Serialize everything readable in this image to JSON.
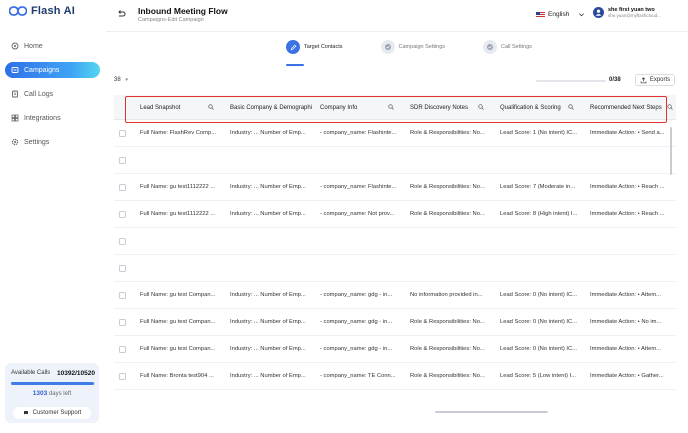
{
  "app": {
    "logo_text": "Flash AI",
    "nav": [
      {
        "label": "Home",
        "icon": "home-icon",
        "active": false
      },
      {
        "label": "Campaigns",
        "icon": "campaign-icon",
        "active": true
      },
      {
        "label": "Call Logs",
        "icon": "call-logs-icon",
        "active": false
      },
      {
        "label": "Integrations",
        "icon": "integrations-icon",
        "active": false
      },
      {
        "label": "Settings",
        "icon": "settings-icon",
        "active": false
      }
    ],
    "calls": {
      "label": "Available Calls",
      "value": "10392/10520",
      "fraction": 0.988,
      "days_number": "1303",
      "days_label": "days left",
      "support_label": "Customer Support"
    }
  },
  "header": {
    "title": "Inbound Meeting Flow",
    "subtitle": "Campaigns-Edit Campaign",
    "language": "English",
    "user_name": "she first yuan two",
    "user_email": "she.yuan@myflashcloud..."
  },
  "steps": [
    {
      "label": "Target Contacts",
      "icon": "edit-icon",
      "active": true
    },
    {
      "label": "Campaign Settings",
      "icon": "check-icon",
      "active": false
    },
    {
      "label": "Call Settings",
      "icon": "check-icon",
      "active": false
    }
  ],
  "toolbar": {
    "page_size": "38",
    "selected_count": "0/38",
    "export_label": "Exports"
  },
  "table": {
    "columns": [
      "Lead Snapshot",
      "Basic Company & Demographi",
      "Company Info",
      "SDR Discovery Notes",
      "Qualification & Scoring",
      "Recommended Next Steps"
    ],
    "rows": [
      [
        "Full Name: FlashRev Comp...",
        "Industry: ... Number of Emp...",
        "- company_name: Flashinte...",
        "Role & Responsibilities: No...",
        "Lead Score: 1 (No intent) IC...",
        "Immediate Action: • Send a..."
      ],
      [
        "",
        "",
        "",
        "",
        "",
        ""
      ],
      [
        "Full Name: gu test1112222 ...",
        "Industry: ... Number of Emp...",
        "- company_name: Flashinte...",
        "Role & Responsibilities: No...",
        "Lead Score: 7 (Moderate in...",
        "Immediate Action: • Reach ..."
      ],
      [
        "Full Name: gu test1112222 ...",
        "Industry: ... Number of Emp...",
        "- company_name: Not prov...",
        "Role & Responsibilities: No...",
        "Lead Score: 8 (High intent) I...",
        "Immediate Action: • Reach ..."
      ],
      [
        "",
        "",
        "",
        "",
        "",
        ""
      ],
      [
        "",
        "",
        "",
        "",
        "",
        ""
      ],
      [
        "Full Name: gu test Compan...",
        "Industry: ... Number of Emp...",
        "- company_name: gdg - in...",
        "No information provided in...",
        "Lead Score: 0 (No intent) IC...",
        "Immediate Action: • Attem..."
      ],
      [
        "Full Name: gu test Compan...",
        "Industry: ... Number of Emp...",
        "- company_name: gdg - in...",
        "Role & Responsibilities: No...",
        "Lead Score: 0 (No intent) IC...",
        "Immediate Action: • No im..."
      ],
      [
        "Full Name: gu test Compan...",
        "Industry: ... Number of Emp...",
        "- company_name: gdg - in...",
        "Role & Responsibilities: No...",
        "Lead Score: 0 (No intent) IC...",
        "Immediate Action: • Attem..."
      ],
      [
        "Full Name: Bronta test904 ...",
        "Industry: ... Number of Emp...",
        "- company_name: TE Conn...",
        "Role & Responsibilities: No...",
        "Lead Score: 5 (Low intent) I...",
        "Immediate Action: • Gather..."
      ]
    ]
  },
  "colors": {
    "accent": "#3b72e6",
    "highlight_border": "#e33232"
  }
}
